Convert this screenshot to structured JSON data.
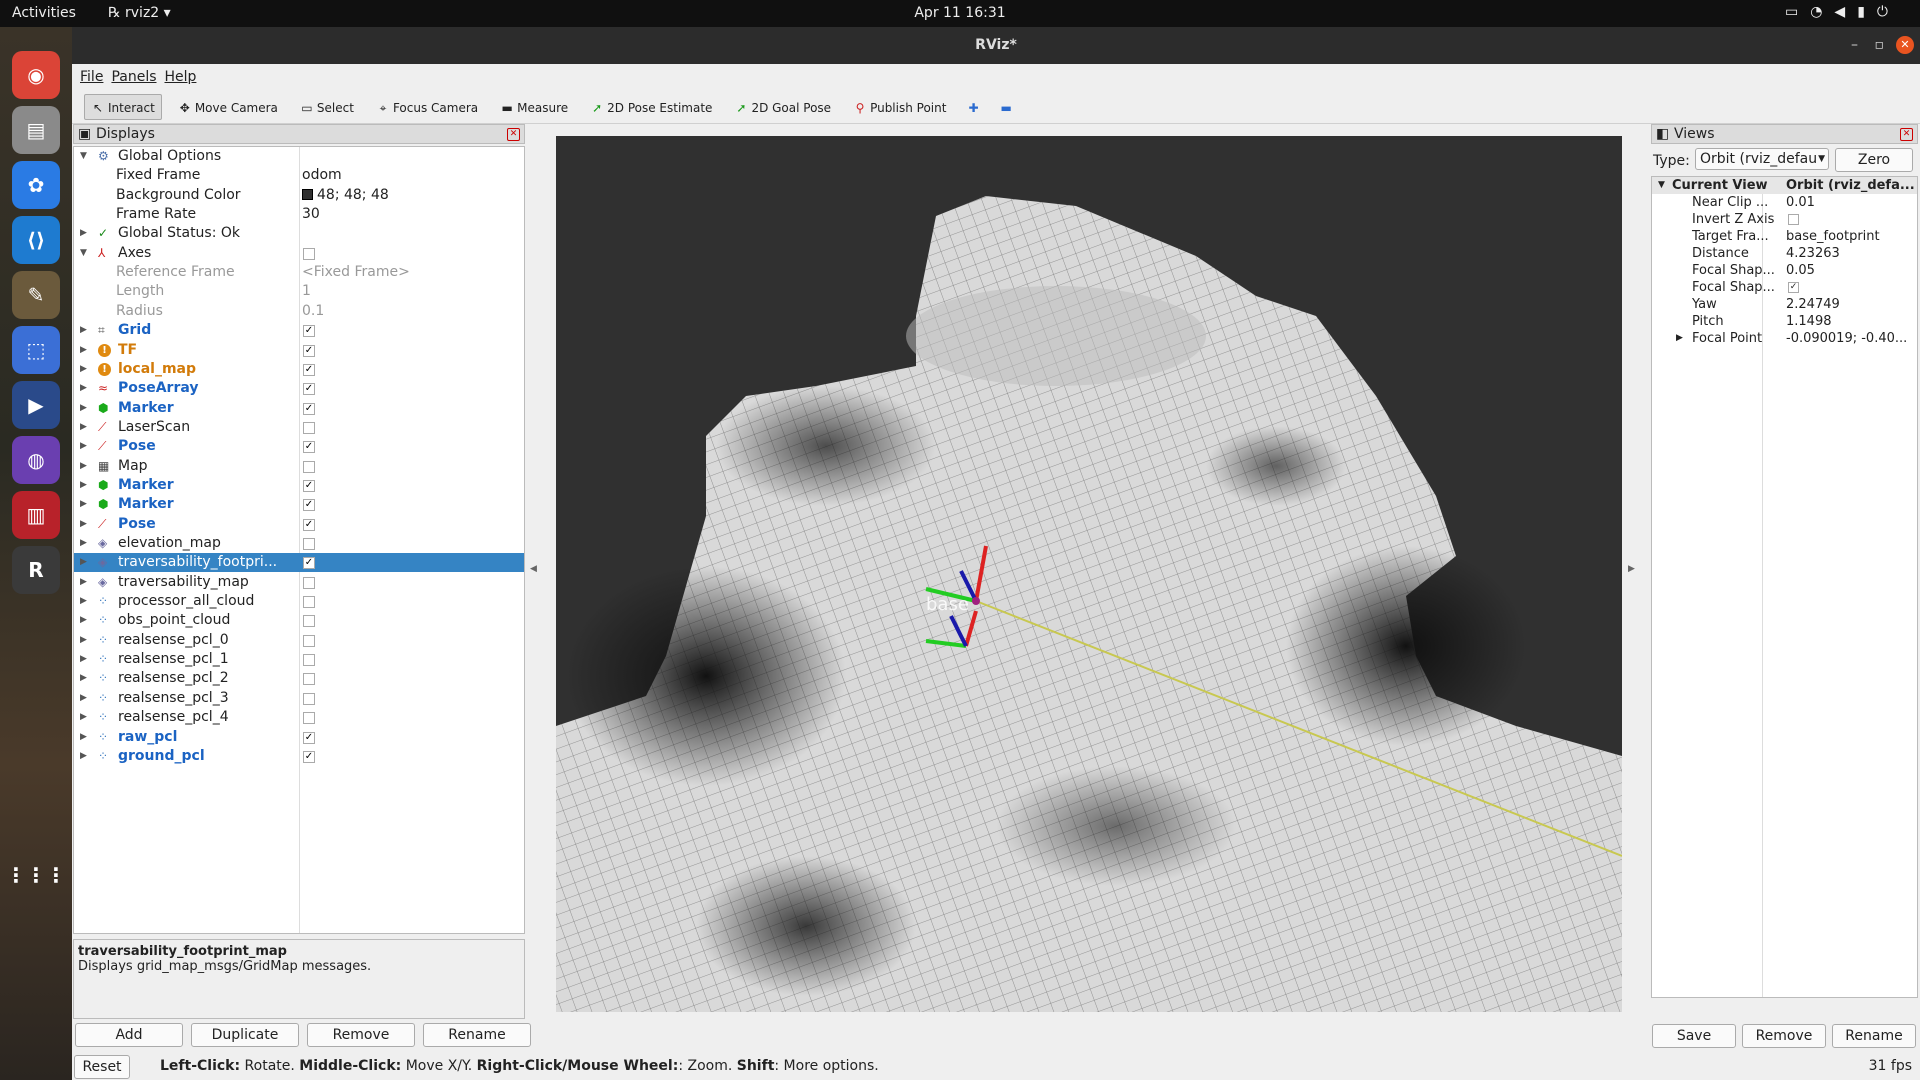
{
  "system": {
    "activities": "Activities",
    "app_menu": "rviz2",
    "clock": "Apr 11  16:31"
  },
  "window": {
    "title": "RViz*"
  },
  "menu": [
    "File",
    "Panels",
    "Help"
  ],
  "toolbar": [
    {
      "label": "Interact",
      "icon": "cursor-icon",
      "active": true
    },
    {
      "label": "Move Camera",
      "icon": "move-camera-icon"
    },
    {
      "label": "Select",
      "icon": "select-icon"
    },
    {
      "label": "Focus Camera",
      "icon": "focus-camera-icon"
    },
    {
      "label": "Measure",
      "icon": "ruler-icon"
    },
    {
      "label": "2D Pose Estimate",
      "icon": "green-arrow-icon"
    },
    {
      "label": "2D Goal Pose",
      "icon": "green-arrow-icon"
    },
    {
      "label": "Publish Point",
      "icon": "map-pin-icon"
    }
  ],
  "displays": {
    "title": "Displays",
    "rows": [
      {
        "name": "Global Options",
        "icon": "gear-icon",
        "expanded": true,
        "level": 0
      },
      {
        "name": "Fixed Frame",
        "value": "odom",
        "level": 1
      },
      {
        "name": "Background Color",
        "value": "48; 48; 48",
        "swatch": "#303030",
        "level": 1
      },
      {
        "name": "Frame Rate",
        "value": "30",
        "level": 1
      },
      {
        "name": "Global Status: Ok",
        "icon": "check-icon",
        "level": 0
      },
      {
        "name": "Axes",
        "icon": "axes-icon",
        "expanded": true,
        "level": 0,
        "checked": false
      },
      {
        "name": "Reference Frame",
        "value": "<Fixed Frame>",
        "level": 1,
        "style": "grey"
      },
      {
        "name": "Length",
        "value": "1",
        "level": 1,
        "style": "grey"
      },
      {
        "name": "Radius",
        "value": "0.1",
        "level": 1,
        "style": "grey"
      },
      {
        "name": "Grid",
        "icon": "grid-icon",
        "checked": true,
        "style": "blue"
      },
      {
        "name": "TF",
        "icon": "warning-icon",
        "checked": true,
        "style": "orange"
      },
      {
        "name": "local_map",
        "icon": "warning-icon",
        "checked": true,
        "style": "orange"
      },
      {
        "name": "PoseArray",
        "icon": "pose-array-icon",
        "checked": true,
        "style": "blue"
      },
      {
        "name": "Marker",
        "icon": "marker-cube-icon",
        "checked": true,
        "style": "blue"
      },
      {
        "name": "LaserScan",
        "icon": "laser-icon",
        "checked": false
      },
      {
        "name": "Pose",
        "icon": "pose-arrow-icon",
        "checked": true,
        "style": "blue"
      },
      {
        "name": "Map",
        "icon": "map-icon",
        "checked": false
      },
      {
        "name": "Marker",
        "icon": "marker-cube-icon",
        "checked": true,
        "style": "blue"
      },
      {
        "name": "Marker",
        "icon": "marker-cube-icon",
        "checked": true,
        "style": "blue"
      },
      {
        "name": "Pose",
        "icon": "pose-arrow-icon",
        "checked": true,
        "style": "blue"
      },
      {
        "name": "elevation_map",
        "icon": "gridmap-icon",
        "checked": false
      },
      {
        "name": "traversability_footpri...",
        "icon": "gridmap-icon",
        "checked": true,
        "style": "selected"
      },
      {
        "name": "traversability_map",
        "icon": "gridmap-icon",
        "checked": false
      },
      {
        "name": "processor_all_cloud",
        "icon": "pointcloud-icon",
        "checked": false
      },
      {
        "name": "obs_point_cloud",
        "icon": "pointcloud-icon",
        "checked": false
      },
      {
        "name": "realsense_pcl_0",
        "icon": "pointcloud-icon",
        "checked": false
      },
      {
        "name": "realsense_pcl_1",
        "icon": "pointcloud-icon",
        "checked": false
      },
      {
        "name": "realsense_pcl_2",
        "icon": "pointcloud-icon",
        "checked": false
      },
      {
        "name": "realsense_pcl_3",
        "icon": "pointcloud-icon",
        "checked": false
      },
      {
        "name": "realsense_pcl_4",
        "icon": "pointcloud-icon",
        "checked": false
      },
      {
        "name": "raw_pcl",
        "icon": "pointcloud-icon",
        "checked": true,
        "style": "blue"
      },
      {
        "name": "ground_pcl",
        "icon": "pointcloud-icon",
        "checked": true,
        "style": "blue"
      }
    ],
    "desc_title": "traversability_footprint_map",
    "desc_text": "Displays grid_map_msgs/GridMap messages.",
    "buttons": [
      "Add",
      "Duplicate",
      "Remove",
      "Rename"
    ]
  },
  "viewport": {
    "frame_label": "base"
  },
  "views": {
    "title": "Views",
    "type_label": "Type:",
    "type_value": "Orbit (rviz_defau",
    "zero": "Zero",
    "header": [
      "Current View",
      "Orbit (rviz_defa..."
    ],
    "rows": [
      {
        "k": "Near Clip ...",
        "v": "0.01"
      },
      {
        "k": "Invert Z Axis",
        "v": "",
        "cb": false
      },
      {
        "k": "Target Fra...",
        "v": "base_footprint"
      },
      {
        "k": "Distance",
        "v": "4.23263"
      },
      {
        "k": "Focal Shap...",
        "v": "0.05"
      },
      {
        "k": "Focal Shap...",
        "v": "",
        "cb": true
      },
      {
        "k": "Yaw",
        "v": "2.24749"
      },
      {
        "k": "Pitch",
        "v": "1.1498"
      },
      {
        "k": "Focal Point",
        "v": "-0.090019; -0.40...",
        "expand": true
      }
    ],
    "buttons": [
      "Save",
      "Remove",
      "Rename"
    ]
  },
  "status": {
    "reset": "Reset",
    "hint_parts": [
      [
        "Left-Click:",
        " Rotate. "
      ],
      [
        "Middle-Click:",
        " Move X/Y. "
      ],
      [
        "Right-Click/Mouse Wheel:",
        ": Zoom. "
      ],
      [
        "Shift",
        ": More options."
      ]
    ],
    "fps": "31 fps"
  },
  "dock": [
    {
      "icon": "chrome-icon",
      "color": "#db4437"
    },
    {
      "icon": "files-icon",
      "color": "#8a8a8a"
    },
    {
      "icon": "baidu-netdisk-icon",
      "color": "#2a7be4"
    },
    {
      "icon": "vscode-icon",
      "color": "#1e7bd0"
    },
    {
      "icon": "gimp-icon",
      "color": "#6b5a3c"
    },
    {
      "icon": "screenshot-icon",
      "color": "#3b6fd6"
    },
    {
      "icon": "media-player-icon",
      "color": "#2a4a8a"
    },
    {
      "icon": "globe-icon",
      "color": "#6a3fb0"
    },
    {
      "icon": "terminal-red-icon",
      "color": "#b8222a"
    },
    {
      "icon": "rviz-icon",
      "color": "#3a3a3a"
    },
    {
      "icon": "app-grid-icon",
      "color": "transparent"
    }
  ]
}
